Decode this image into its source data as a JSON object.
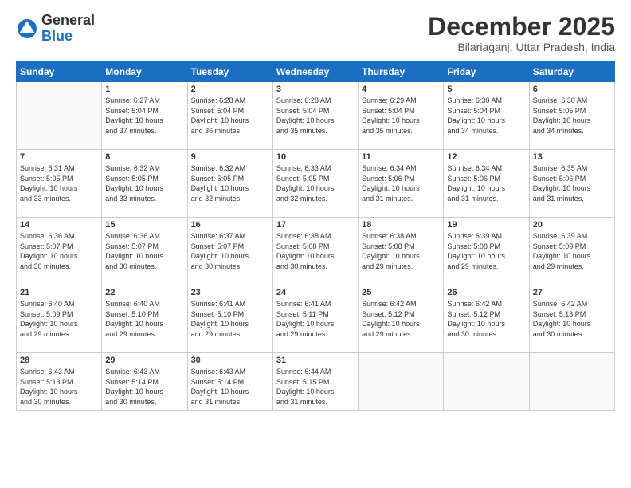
{
  "header": {
    "logo_general": "General",
    "logo_blue": "Blue",
    "month_title": "December 2025",
    "location": "Bilariaganj, Uttar Pradesh, India"
  },
  "days_of_week": [
    "Sunday",
    "Monday",
    "Tuesday",
    "Wednesday",
    "Thursday",
    "Friday",
    "Saturday"
  ],
  "weeks": [
    [
      {
        "num": "",
        "info": ""
      },
      {
        "num": "1",
        "info": "Sunrise: 6:27 AM\nSunset: 5:04 PM\nDaylight: 10 hours\nand 37 minutes."
      },
      {
        "num": "2",
        "info": "Sunrise: 6:28 AM\nSunset: 5:04 PM\nDaylight: 10 hours\nand 36 minutes."
      },
      {
        "num": "3",
        "info": "Sunrise: 6:28 AM\nSunset: 5:04 PM\nDaylight: 10 hours\nand 35 minutes."
      },
      {
        "num": "4",
        "info": "Sunrise: 6:29 AM\nSunset: 5:04 PM\nDaylight: 10 hours\nand 35 minutes."
      },
      {
        "num": "5",
        "info": "Sunrise: 6:30 AM\nSunset: 5:04 PM\nDaylight: 10 hours\nand 34 minutes."
      },
      {
        "num": "6",
        "info": "Sunrise: 6:30 AM\nSunset: 5:05 PM\nDaylight: 10 hours\nand 34 minutes."
      }
    ],
    [
      {
        "num": "7",
        "info": "Sunrise: 6:31 AM\nSunset: 5:05 PM\nDaylight: 10 hours\nand 33 minutes."
      },
      {
        "num": "8",
        "info": "Sunrise: 6:32 AM\nSunset: 5:05 PM\nDaylight: 10 hours\nand 33 minutes."
      },
      {
        "num": "9",
        "info": "Sunrise: 6:32 AM\nSunset: 5:05 PM\nDaylight: 10 hours\nand 32 minutes."
      },
      {
        "num": "10",
        "info": "Sunrise: 6:33 AM\nSunset: 5:05 PM\nDaylight: 10 hours\nand 32 minutes."
      },
      {
        "num": "11",
        "info": "Sunrise: 6:34 AM\nSunset: 5:06 PM\nDaylight: 10 hours\nand 31 minutes."
      },
      {
        "num": "12",
        "info": "Sunrise: 6:34 AM\nSunset: 5:06 PM\nDaylight: 10 hours\nand 31 minutes."
      },
      {
        "num": "13",
        "info": "Sunrise: 6:35 AM\nSunset: 5:06 PM\nDaylight: 10 hours\nand 31 minutes."
      }
    ],
    [
      {
        "num": "14",
        "info": "Sunrise: 6:36 AM\nSunset: 5:07 PM\nDaylight: 10 hours\nand 30 minutes."
      },
      {
        "num": "15",
        "info": "Sunrise: 6:36 AM\nSunset: 5:07 PM\nDaylight: 10 hours\nand 30 minutes."
      },
      {
        "num": "16",
        "info": "Sunrise: 6:37 AM\nSunset: 5:07 PM\nDaylight: 10 hours\nand 30 minutes."
      },
      {
        "num": "17",
        "info": "Sunrise: 6:38 AM\nSunset: 5:08 PM\nDaylight: 10 hours\nand 30 minutes."
      },
      {
        "num": "18",
        "info": "Sunrise: 6:38 AM\nSunset: 5:08 PM\nDaylight: 10 hours\nand 29 minutes."
      },
      {
        "num": "19",
        "info": "Sunrise: 6:39 AM\nSunset: 5:08 PM\nDaylight: 10 hours\nand 29 minutes."
      },
      {
        "num": "20",
        "info": "Sunrise: 6:39 AM\nSunset: 5:09 PM\nDaylight: 10 hours\nand 29 minutes."
      }
    ],
    [
      {
        "num": "21",
        "info": "Sunrise: 6:40 AM\nSunset: 5:09 PM\nDaylight: 10 hours\nand 29 minutes."
      },
      {
        "num": "22",
        "info": "Sunrise: 6:40 AM\nSunset: 5:10 PM\nDaylight: 10 hours\nand 29 minutes."
      },
      {
        "num": "23",
        "info": "Sunrise: 6:41 AM\nSunset: 5:10 PM\nDaylight: 10 hours\nand 29 minutes."
      },
      {
        "num": "24",
        "info": "Sunrise: 6:41 AM\nSunset: 5:11 PM\nDaylight: 10 hours\nand 29 minutes."
      },
      {
        "num": "25",
        "info": "Sunrise: 6:42 AM\nSunset: 5:12 PM\nDaylight: 10 hours\nand 29 minutes."
      },
      {
        "num": "26",
        "info": "Sunrise: 6:42 AM\nSunset: 5:12 PM\nDaylight: 10 hours\nand 30 minutes."
      },
      {
        "num": "27",
        "info": "Sunrise: 6:42 AM\nSunset: 5:13 PM\nDaylight: 10 hours\nand 30 minutes."
      }
    ],
    [
      {
        "num": "28",
        "info": "Sunrise: 6:43 AM\nSunset: 5:13 PM\nDaylight: 10 hours\nand 30 minutes."
      },
      {
        "num": "29",
        "info": "Sunrise: 6:43 AM\nSunset: 5:14 PM\nDaylight: 10 hours\nand 30 minutes."
      },
      {
        "num": "30",
        "info": "Sunrise: 6:43 AM\nSunset: 5:14 PM\nDaylight: 10 hours\nand 31 minutes."
      },
      {
        "num": "31",
        "info": "Sunrise: 6:44 AM\nSunset: 5:15 PM\nDaylight: 10 hours\nand 31 minutes."
      },
      {
        "num": "",
        "info": ""
      },
      {
        "num": "",
        "info": ""
      },
      {
        "num": "",
        "info": ""
      }
    ]
  ]
}
